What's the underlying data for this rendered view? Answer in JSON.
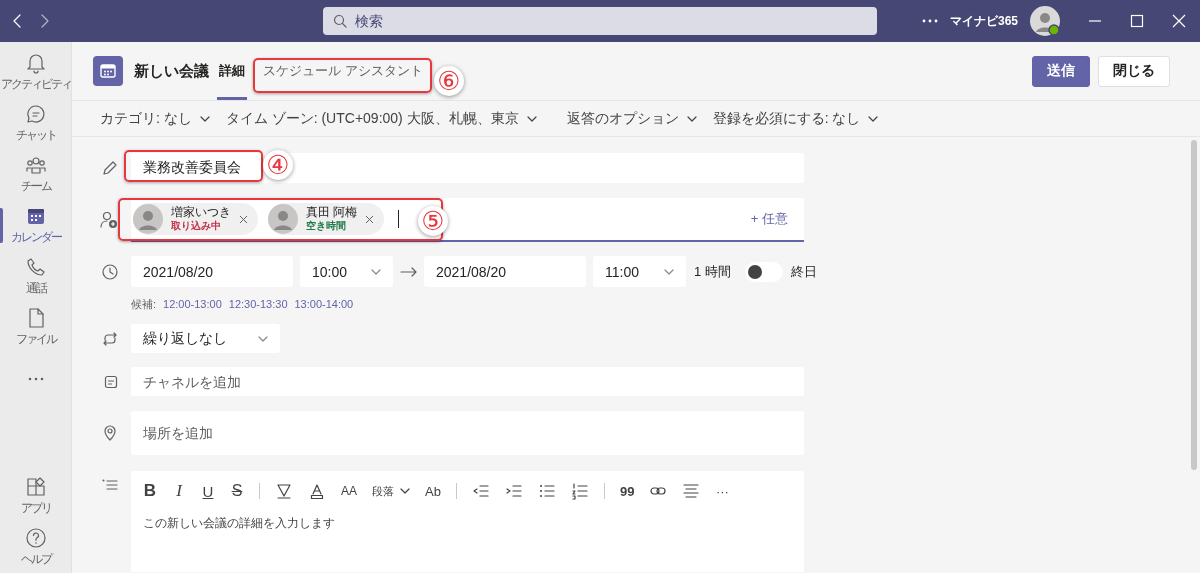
{
  "titlebar": {
    "search": {
      "placeholder": "検索"
    },
    "account_name": "マイナビ365"
  },
  "rail": {
    "items": [
      {
        "kind": "nav",
        "label": "アクティビティ",
        "selected": false
      },
      {
        "kind": "nav",
        "label": "チャット",
        "selected": false
      },
      {
        "kind": "nav",
        "label": "チーム",
        "selected": false
      },
      {
        "kind": "nav",
        "label": "カレンダー",
        "selected": true
      },
      {
        "kind": "nav",
        "label": "通話",
        "selected": false
      },
      {
        "kind": "nav",
        "label": "ファイル",
        "selected": false
      },
      {
        "kind": "more",
        "selected": false
      }
    ],
    "bottom_items": [
      {
        "kind": "nav",
        "label": "アプリ",
        "selected": false
      },
      {
        "kind": "nav",
        "label": "ヘルプ",
        "selected": false
      }
    ]
  },
  "header": {
    "title": "新しい会議",
    "tabs": [
      {
        "label": "詳細",
        "selected": true
      },
      {
        "label": "スケジュール アシスタント",
        "selected": false
      }
    ],
    "buttons": [
      {
        "label": "送信",
        "kind": "primary"
      },
      {
        "label": "閉じる",
        "kind": "secondary"
      }
    ]
  },
  "options": [
    "カテゴリ: なし",
    "タイム ゾーン: (UTC+09:00) 大阪、札幌、東京",
    "返答のオプション",
    "登録を必須にする: なし"
  ],
  "form": {
    "title": {
      "value": "業務改善委員会"
    },
    "attendees": [
      {
        "name": "増家いつき",
        "status": "取り込み中",
        "color": "#c4314b"
      },
      {
        "name": "真田 阿梅",
        "status": "空き時間",
        "color": "#237b4b"
      }
    ],
    "optional_link": "+ 任意",
    "start_date": "2021/08/20",
    "start_time": "10:00",
    "end_date": "2021/08/20",
    "end_time": "11:00",
    "duration": "1 時間",
    "all_day": {
      "label": "終日",
      "on": false
    },
    "suggestions": {
      "label": "候補:",
      "times": [
        "12:00-13:00",
        "12:30-13:30",
        "13:00-14:00"
      ]
    },
    "repeat": "繰り返しなし",
    "channel": {
      "placeholder": "チャネルを追加"
    },
    "location": {
      "placeholder": "場所を追加"
    }
  },
  "editor": {
    "toolbar": [
      {
        "kind": "glyph",
        "text": "B"
      },
      {
        "kind": "glyph",
        "text": "I"
      },
      {
        "kind": "glyph",
        "text": "U"
      },
      {
        "kind": "glyph",
        "text": "S"
      },
      {
        "kind": "separator"
      },
      {
        "kind": "icon"
      },
      {
        "kind": "icon"
      },
      {
        "kind": "glyph",
        "text": "AA"
      },
      {
        "kind": "dropdown",
        "text": "段落"
      },
      {
        "kind": "glyph",
        "text": "Ab"
      },
      {
        "kind": "separator"
      },
      {
        "kind": "icon"
      },
      {
        "kind": "icon"
      },
      {
        "kind": "icon"
      },
      {
        "kind": "icon"
      },
      {
        "kind": "separator"
      },
      {
        "kind": "glyph",
        "text": "99"
      },
      {
        "kind": "icon"
      },
      {
        "kind": "icon"
      },
      {
        "kind": "glyph",
        "text": "···"
      }
    ],
    "placeholder": "この新しい会議の詳細を入力します"
  },
  "annotations": [
    {
      "number": "⑥"
    },
    {
      "number": "④"
    },
    {
      "number": "⑤"
    }
  ]
}
